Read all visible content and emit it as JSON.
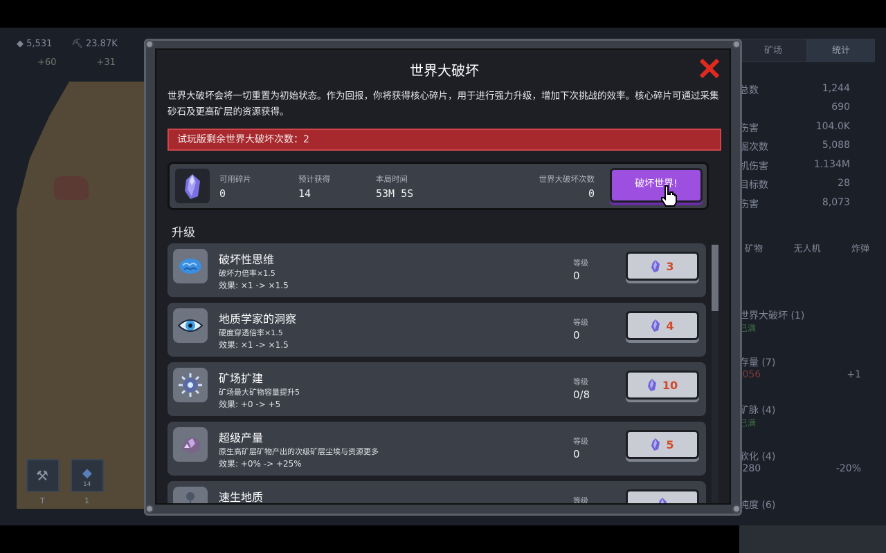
{
  "background_hud": {
    "resource_a": "5,531",
    "resource_b": "23.87K",
    "rate_a": "+60",
    "rate_b": "+31",
    "tool_slots": [
      {
        "icon": "pickaxe-icon",
        "key": "T"
      },
      {
        "icon": "crystal-icon",
        "count": "14",
        "key": "1"
      }
    ]
  },
  "right_panel": {
    "tabs": [
      {
        "label": "矿场",
        "key": "Q"
      },
      {
        "label": "统计",
        "key": "S"
      }
    ],
    "stats": [
      {
        "label": "总数",
        "value": "1,244"
      },
      {
        "label": "",
        "value": "690"
      },
      {
        "label": "伤害",
        "value": "104.0K"
      },
      {
        "label": "掘次数",
        "value": "5,088"
      },
      {
        "label": "机伤害",
        "value": "1.134M"
      },
      {
        "label": "目标数",
        "value": "28"
      },
      {
        "label": "伤害",
        "value": "8,073"
      }
    ],
    "sub_tabs": [
      "矿物",
      "无人机",
      "炸弹"
    ],
    "cards": [
      {
        "title": "世界大破坏 (1)",
        "status": "已满"
      },
      {
        "title": "存量 (7)",
        "value": ",056",
        "delta": "+1"
      },
      {
        "title": "矿脉 (4)",
        "status": "已满"
      },
      {
        "title": "软化 (4)",
        "value": ",280",
        "delta": "-20%"
      },
      {
        "title": "纯度 (6)"
      }
    ]
  },
  "modal": {
    "title": "世界大破坏",
    "close_icon": "close-x-icon",
    "description": "世界大破坏会将一切重置为初始状态。作为回报，你将获得核心碎片，用于进行强力升级，增加下次挑战的效率。核心碎片可通过采集砂石及更高矿层的资源获得。",
    "trial_banner": "试玩版剩余世界大破坏次数：2",
    "info": {
      "available_label": "可用碎片",
      "available_value": "0",
      "expected_label": "预计获得",
      "expected_value": "14",
      "time_label": "本局时间",
      "time_value": "53M 5S",
      "count_label": "世界大破坏次数",
      "count_value": "0",
      "destroy_button": "破坏世界!"
    },
    "section_title": "升级",
    "upgrades": [
      {
        "name": "破坏性思维",
        "desc": "破坏力倍率×1.5",
        "effect": "效果: ×1 -> ×1.5",
        "level_label": "等级",
        "level": "0",
        "cost": "3",
        "icon": "brain-icon"
      },
      {
        "name": "地质学家的洞察",
        "desc": "硬度穿透倍率×1.5",
        "effect": "效果: ×1 -> ×1.5",
        "level_label": "等级",
        "level": "0",
        "cost": "4",
        "icon": "eye-icon"
      },
      {
        "name": "矿场扩建",
        "desc": "矿场最大矿物容量提升5",
        "effect": "效果: +0 -> +5",
        "level_label": "等级",
        "level": "0/8",
        "cost": "10",
        "icon": "gear-crystal-icon"
      },
      {
        "name": "超级产量",
        "desc": "原生高矿层矿物产出的次级矿层尘埃与资源更多",
        "effect": "效果: +0% -> +25%",
        "level_label": "等级",
        "level": "0",
        "cost": "5",
        "icon": "ore-cluster-icon"
      },
      {
        "name": "速生地质",
        "desc": "",
        "effect": "",
        "level_label": "等级",
        "level": "",
        "cost": "",
        "icon": "sprout-icon"
      }
    ]
  },
  "colors": {
    "banner_red": "#a8292d",
    "destroy_purple": "#9d4fe0",
    "cost_orange": "#d14a2a",
    "close_red": "#e02a1f"
  }
}
